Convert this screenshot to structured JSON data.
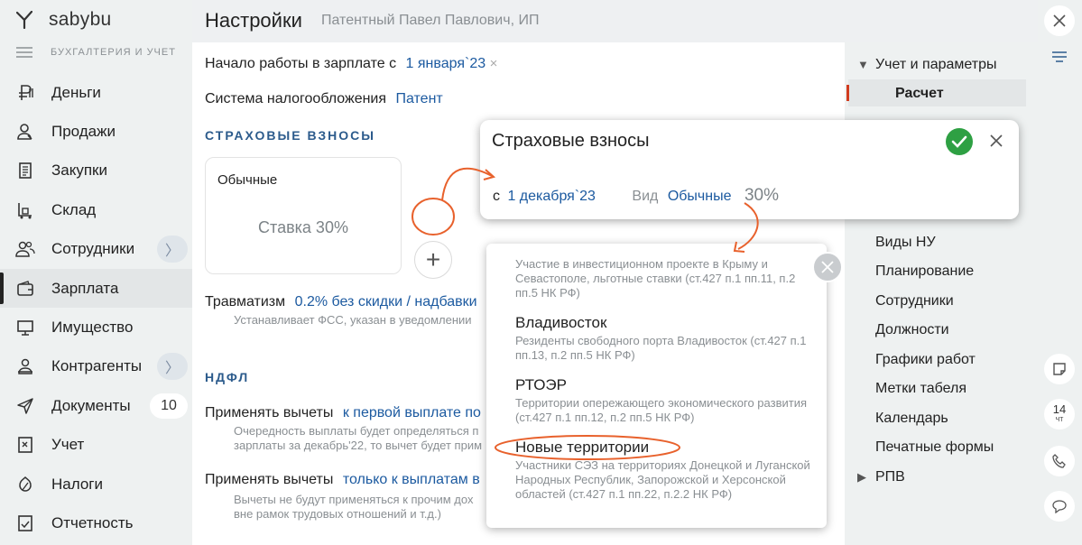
{
  "brand": {
    "name_prefix": "saby",
    "name_suffix": "bu",
    "subtitle": "БУХГАЛТЕРИЯ И УЧЕТ"
  },
  "sidebar": {
    "items": [
      {
        "label": "Деньги",
        "icon": "ruble-icon"
      },
      {
        "label": "Продажи",
        "icon": "sales-icon"
      },
      {
        "label": "Закупки",
        "icon": "receipt-icon"
      },
      {
        "label": "Склад",
        "icon": "warehouse-icon"
      },
      {
        "label": "Сотрудники",
        "icon": "people-icon",
        "chevron": "〉"
      },
      {
        "label": "Зарплата",
        "icon": "wallet-icon",
        "active": true
      },
      {
        "label": "Имущество",
        "icon": "monitor-icon"
      },
      {
        "label": "Контрагенты",
        "icon": "partners-icon",
        "chevron": "〉"
      },
      {
        "label": "Документы",
        "icon": "send-icon",
        "count": "10"
      },
      {
        "label": "Учет",
        "icon": "ledger-icon"
      },
      {
        "label": "Налоги",
        "icon": "tax-icon"
      },
      {
        "label": "Отчетность",
        "icon": "report-icon"
      }
    ]
  },
  "header": {
    "title": "Настройки",
    "org": "Патентный Павел Павлович, ИП"
  },
  "settings": {
    "start_label": "Начало работы в зарплате с",
    "start_value": "1 января`23",
    "clear": "×",
    "tax_label": "Система налогообложения",
    "tax_value": "Патент",
    "insurance_section": "СТРАХОВЫЕ ВЗНОСЫ",
    "card_title": "Обычные",
    "card_rate": "Ставка 30%",
    "plus": "+",
    "injury_label": "Травматизм",
    "injury_value": "0.2% без скидки / надбавки",
    "injury_hint": "Устанавливает ФСС, указан в уведомлении",
    "ndfl_section": "НДФЛ",
    "deduct1_label": "Применять вычеты",
    "deduct1_value": "к первой выплате по",
    "deduct1_hint1": "Очередность выплаты будет определяться п",
    "deduct1_hint2": "зарплаты за декабрь'22, то вычет будет прим",
    "deduct2_label": "Применять вычеты",
    "deduct2_value": "только к выплатам в",
    "deduct2_hint1": "Вычеты не будут применяться к прочим дох",
    "deduct2_hint2": "вне рамок трудовых отношений и т.д.)"
  },
  "right_nav": {
    "top_item": "Учет и параметры",
    "selected": "Расчет",
    "items": [
      "Виды НУ",
      "Планирование",
      "Сотрудники",
      "Должности",
      "Графики работ",
      "Метки табеля",
      "Календарь",
      "Печатные формы"
    ],
    "last": "РПВ"
  },
  "toolbar": {
    "date_day": "14",
    "date_dow": "чт"
  },
  "popup": {
    "title": "Страховые взносы",
    "from_label": "с",
    "from_value": "1 декабря`23",
    "kind_label": "Вид",
    "kind_value": "Обычные",
    "rate": "30%"
  },
  "dropdown": {
    "options": [
      {
        "name": "",
        "desc": "Участие в инвестиционном проекте в Крыму и Севастополе, льготные ставки (ст.427 п.1 пп.11, п.2 пп.5 НК РФ)"
      },
      {
        "name": "Владивосток",
        "desc": "Резиденты свободного порта Владивосток (ст.427 п.1 пп.13, п.2 пп.5 НК РФ)"
      },
      {
        "name": "РТОЭР",
        "desc": "Территории опережающего экономического развития (ст.427 п.1 пп.12, п.2 пп.5 НК РФ)"
      },
      {
        "name": "Новые территории",
        "desc": "Участники СЭЗ на территориях Донецкой и Луганской Народных Республик, Запорожской и Херсонской областей (ст.427 п.1 пп.22, п.2.2 НК РФ)"
      }
    ]
  },
  "colors": {
    "accent_link": "#1c5aa0",
    "annotation": "#e8612c",
    "ok_green": "#2ea043",
    "selection_mark": "#d13c1f"
  }
}
